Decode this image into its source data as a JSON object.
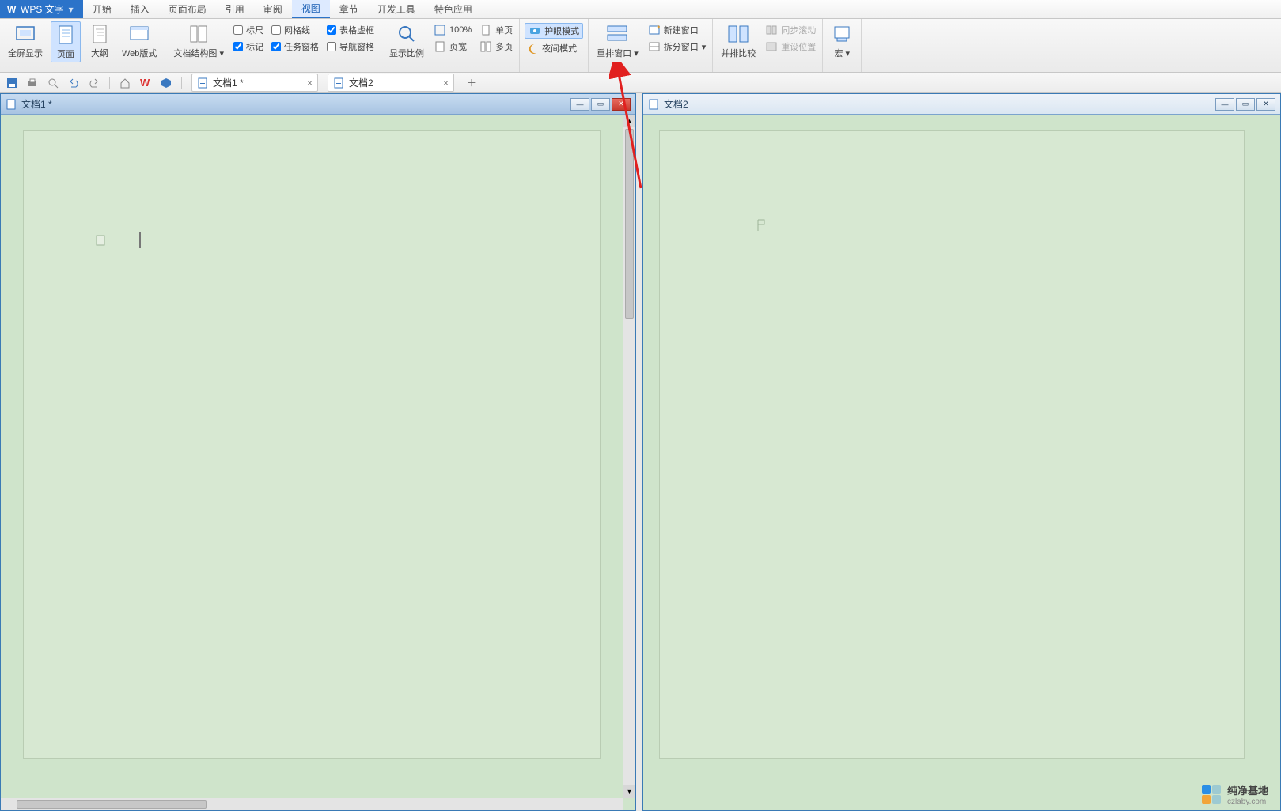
{
  "app": {
    "name": "WPS 文字",
    "logo_letter": "W"
  },
  "menu": {
    "items": [
      "开始",
      "插入",
      "页面布局",
      "引用",
      "审阅",
      "视图",
      "章节",
      "开发工具",
      "特色应用"
    ],
    "active_index": 5
  },
  "ribbon": {
    "views": {
      "fullscreen": "全屏显示",
      "page": "页面",
      "outline": "大纲",
      "web": "Web版式"
    },
    "doc_structure": "文档结构图",
    "checkboxes": {
      "ruler": {
        "label": "标尺",
        "checked": false
      },
      "gridlines": {
        "label": "网格线",
        "checked": false
      },
      "markers": {
        "label": "标记",
        "checked": true
      },
      "task_pane": {
        "label": "任务窗格",
        "checked": true
      },
      "table_borders": {
        "label": "表格虚框",
        "checked": true
      },
      "navigation_pane": {
        "label": "导航窗格",
        "checked": false
      }
    },
    "zoom": {
      "label": "显示比例",
      "percent": "100%"
    },
    "page_buttons": {
      "single_page": "单页",
      "page_width": "页宽",
      "multi_page": "多页"
    },
    "modes": {
      "protect_eye": "护眼模式",
      "night": "夜间模式"
    },
    "windows": {
      "rearrange": "重排窗口",
      "new_window": "新建窗口",
      "split_window": "拆分窗口",
      "compare": "并排比较",
      "sync_scroll": "同步滚动",
      "reset_position": "重设位置",
      "macro": "宏"
    }
  },
  "doc_tabs": [
    {
      "name": "文档1 *",
      "active": true
    },
    {
      "name": "文档2",
      "active": false
    }
  ],
  "panes": {
    "left": {
      "title": "文档1 *"
    },
    "right": {
      "title": "文档2"
    }
  },
  "watermark": {
    "main": "纯净基地",
    "sub": "czlaby.com"
  }
}
